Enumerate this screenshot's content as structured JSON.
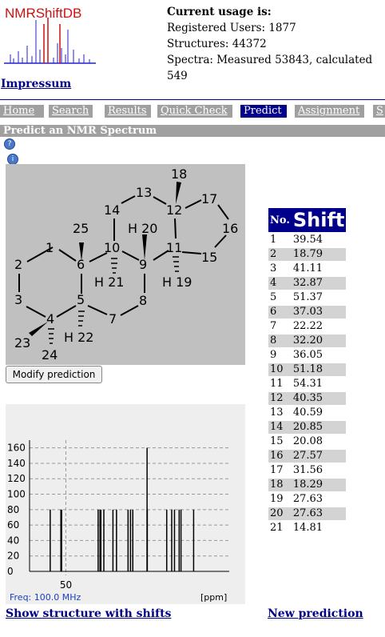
{
  "logo": {
    "text": "NMRShiftDB"
  },
  "usage": {
    "title": "Current usage is:",
    "users": "Registered Users: 1877",
    "structures": "Structures: 44372",
    "spectra": "Spectra: Measured 53843, calculated 549"
  },
  "impressum": "Impressum",
  "tabs": [
    "Home",
    "Search",
    "Results",
    "Quick Check",
    "Predict",
    "Assignment",
    "S"
  ],
  "active_tab": "Predict",
  "section_title": "Predict an NMR Spectrum",
  "molecule": {
    "atoms": [
      "1",
      "2",
      "3",
      "4",
      "5",
      "6",
      "7",
      "8",
      "9",
      "10",
      "11",
      "12",
      "13",
      "14",
      "15",
      "16",
      "17",
      "18",
      "19",
      "20",
      "21",
      "22",
      "23",
      "24",
      "25"
    ],
    "h_labels": [
      "H 19",
      "H 20",
      "H 21",
      "H 22"
    ]
  },
  "modify_button": "Modify prediction",
  "spectrum": {
    "y_ticks": [
      "160",
      "140",
      "120",
      "100",
      "80",
      "60",
      "40",
      "20",
      "0"
    ],
    "x_tick": "50",
    "freq": "Freq: 100.0 MHz",
    "unit": "[ppm]"
  },
  "chart_data": {
    "type": "bar",
    "x": [
      39.54,
      18.79,
      41.11,
      32.87,
      51.37,
      37.03,
      22.22,
      32.2,
      36.05,
      51.18,
      54.31,
      40.35,
      40.59,
      20.85,
      20.08,
      27.57,
      31.56,
      18.29,
      27.63,
      27.63,
      14.81
    ],
    "values": [
      80,
      80,
      80,
      80,
      80,
      80,
      80,
      80,
      80,
      80,
      80,
      80,
      80,
      80,
      80,
      80,
      80,
      80,
      80,
      160,
      80
    ],
    "xlim": [
      60,
      5
    ],
    "ylim": [
      0,
      170
    ],
    "yticks": [
      0,
      20,
      40,
      60,
      80,
      100,
      120,
      140,
      160
    ],
    "xticks": [
      50
    ],
    "grid": true
  },
  "table": {
    "headers": [
      "No.",
      "Shift"
    ],
    "rows": [
      [
        "1",
        "39.54"
      ],
      [
        "2",
        "18.79"
      ],
      [
        "3",
        "41.11"
      ],
      [
        "4",
        "32.87"
      ],
      [
        "5",
        "51.37"
      ],
      [
        "6",
        "37.03"
      ],
      [
        "7",
        "22.22"
      ],
      [
        "8",
        "32.20"
      ],
      [
        "9",
        "36.05"
      ],
      [
        "10",
        "51.18"
      ],
      [
        "11",
        "54.31"
      ],
      [
        "12",
        "40.35"
      ],
      [
        "13",
        "40.59"
      ],
      [
        "14",
        "20.85"
      ],
      [
        "15",
        "20.08"
      ],
      [
        "16",
        "27.57"
      ],
      [
        "17",
        "31.56"
      ],
      [
        "18",
        "18.29"
      ],
      [
        "19",
        "27.63"
      ],
      [
        "20",
        "27.63"
      ],
      [
        "21",
        "14.81"
      ]
    ]
  },
  "links": {
    "show_structure": "Show structure with shifts",
    "new_prediction": "New prediction"
  }
}
